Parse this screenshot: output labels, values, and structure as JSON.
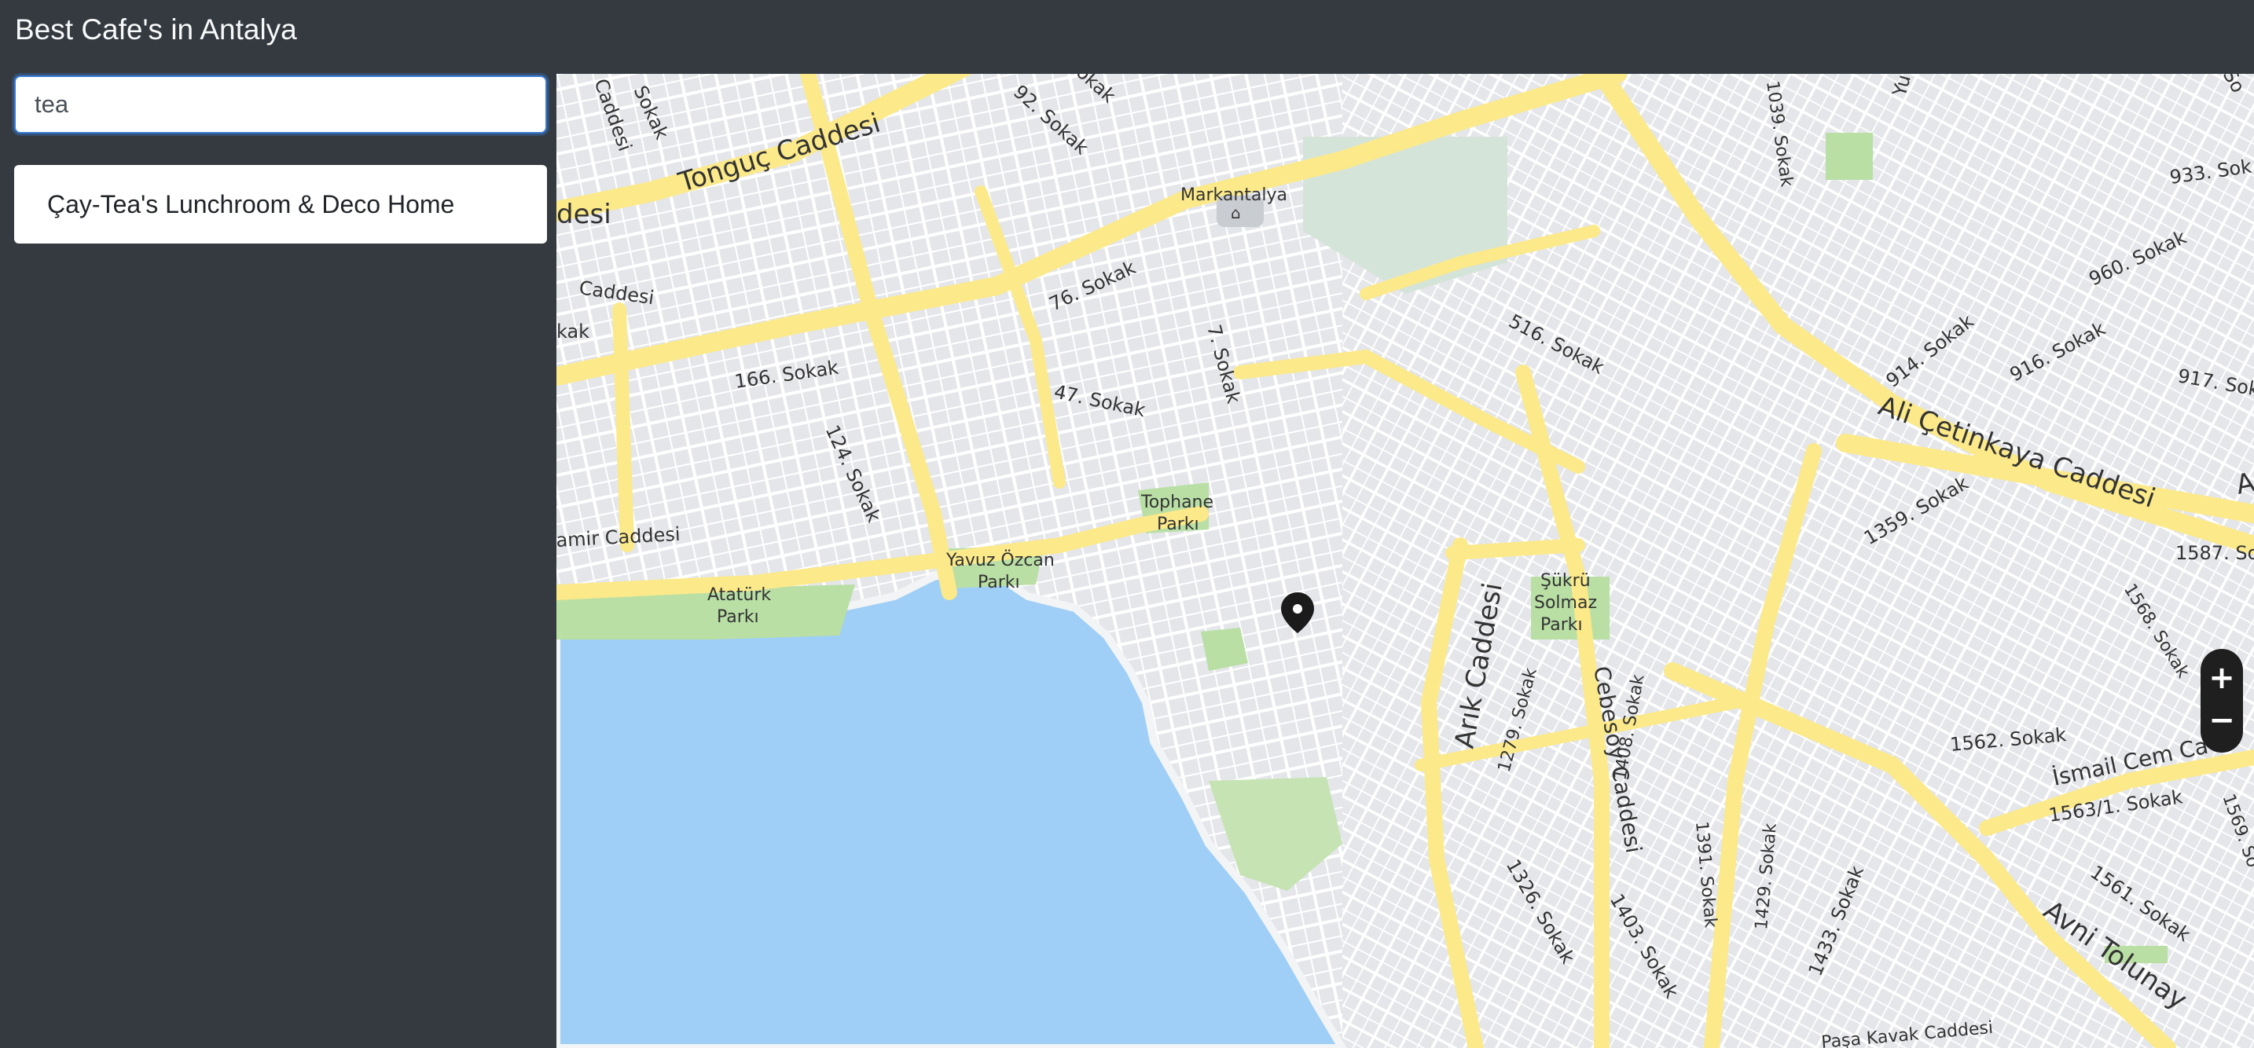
{
  "app": {
    "title": "Best Cafe's in Antalya"
  },
  "search": {
    "value": "tea",
    "placeholder": ""
  },
  "results": [
    {
      "name": "Çay-Tea's Lunchroom & Deco Home"
    }
  ],
  "map": {
    "colors": {
      "water": "#9fcff7",
      "land": "#e4e6ea",
      "major_road": "#fbe98a",
      "minor_road": "#ffffff",
      "park": "#b9dfa5",
      "marker": "#1b1b1b"
    },
    "labels": {
      "tonguc": "Tonguç Caddesi",
      "caddesi_nw": "Caddesi",
      "sokak_nw": "Sokak",
      "desi": "desi",
      "sokak92": "92. Sokak",
      "okak": "okak",
      "markantalya": "Markantalya",
      "caddesi_w": "Caddesi",
      "kak": "kak",
      "sokak76": "76. Sokak",
      "sokak166": "166. Sokak",
      "sokak7": "7. Sokak",
      "sokak47": "47. Sokak",
      "sokak124": "124. Sokak",
      "tophane1": "Tophane",
      "tophane2": "Parkı",
      "yavuz1": "Yavuz Özcan",
      "yavuz2": "Parkı",
      "amir": "amir Caddesi",
      "ataturk1": "Atatürk",
      "ataturk2": "Parkı",
      "sokak516": "516. Sokak",
      "sokak1039": "1039. Sokak",
      "sokak933": "933. Sok",
      "sokak960": "960. Sokak",
      "sokak914": "914. Sokak",
      "sokak916": "916. Sokak",
      "sokak917": "917. Sok",
      "ali": "Ali Çetinkaya Caddesi",
      "sokak1359": "1359. Sokak",
      "sokak1587": "1587. So",
      "sukru1": "Şükrü",
      "sukru2": "Solmaz",
      "sukru3": "Parkı",
      "arik": "Arık Caddesi",
      "sokak1279": "1279. Sokak",
      "cebesoy": "Cebesoy Caddesi",
      "sokak1408": "1408. Sokak",
      "sokak1568": "1568. Sokak",
      "sokak1562": "1562. Sokak",
      "ismail": "İsmail Cem Ca",
      "sokak1563": "1563/1. Sokak",
      "sokak1569": "1569. So",
      "sokak1391": "1391. Sokak",
      "sokak1429": "1429. Sokak",
      "sokak1433": "1433. Sokak",
      "sokak1326": "1326. Sokak",
      "sokak1403": "1403. Sokak",
      "sokak1561": "1561. Sokak",
      "avni": "Avni Tolunay",
      "pasa": "Paşa Kavak Caddesi",
      "yu": "Yu",
      "so": "So",
      "a_right": "A"
    }
  },
  "zoom": {
    "in": "+",
    "out": "−"
  }
}
